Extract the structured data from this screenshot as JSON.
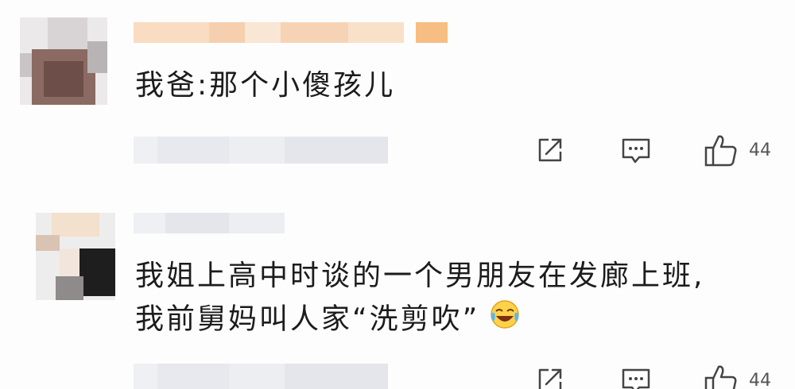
{
  "comments": [
    {
      "text_lines": [
        "我爸:那个小傻孩儿"
      ],
      "like_count": "44",
      "icons": [
        "share-icon",
        "comment-icon",
        "thumbs-up-icon"
      ]
    },
    {
      "text_lines": [
        "我姐上高中时谈的一个男朋友在发廊上班,",
        "我前舅妈叫人家“洗剪吹”"
      ],
      "emoji": "laughing-crying-emoji",
      "like_count": "44",
      "icons": [
        "share-icon",
        "comment-icon",
        "thumbs-up-icon"
      ]
    }
  ],
  "colors": {
    "name_blur": "#f6c9a0",
    "name_accent": "#f4a75a",
    "meta_blur": "#e6e8ee",
    "icon": "#444444"
  }
}
